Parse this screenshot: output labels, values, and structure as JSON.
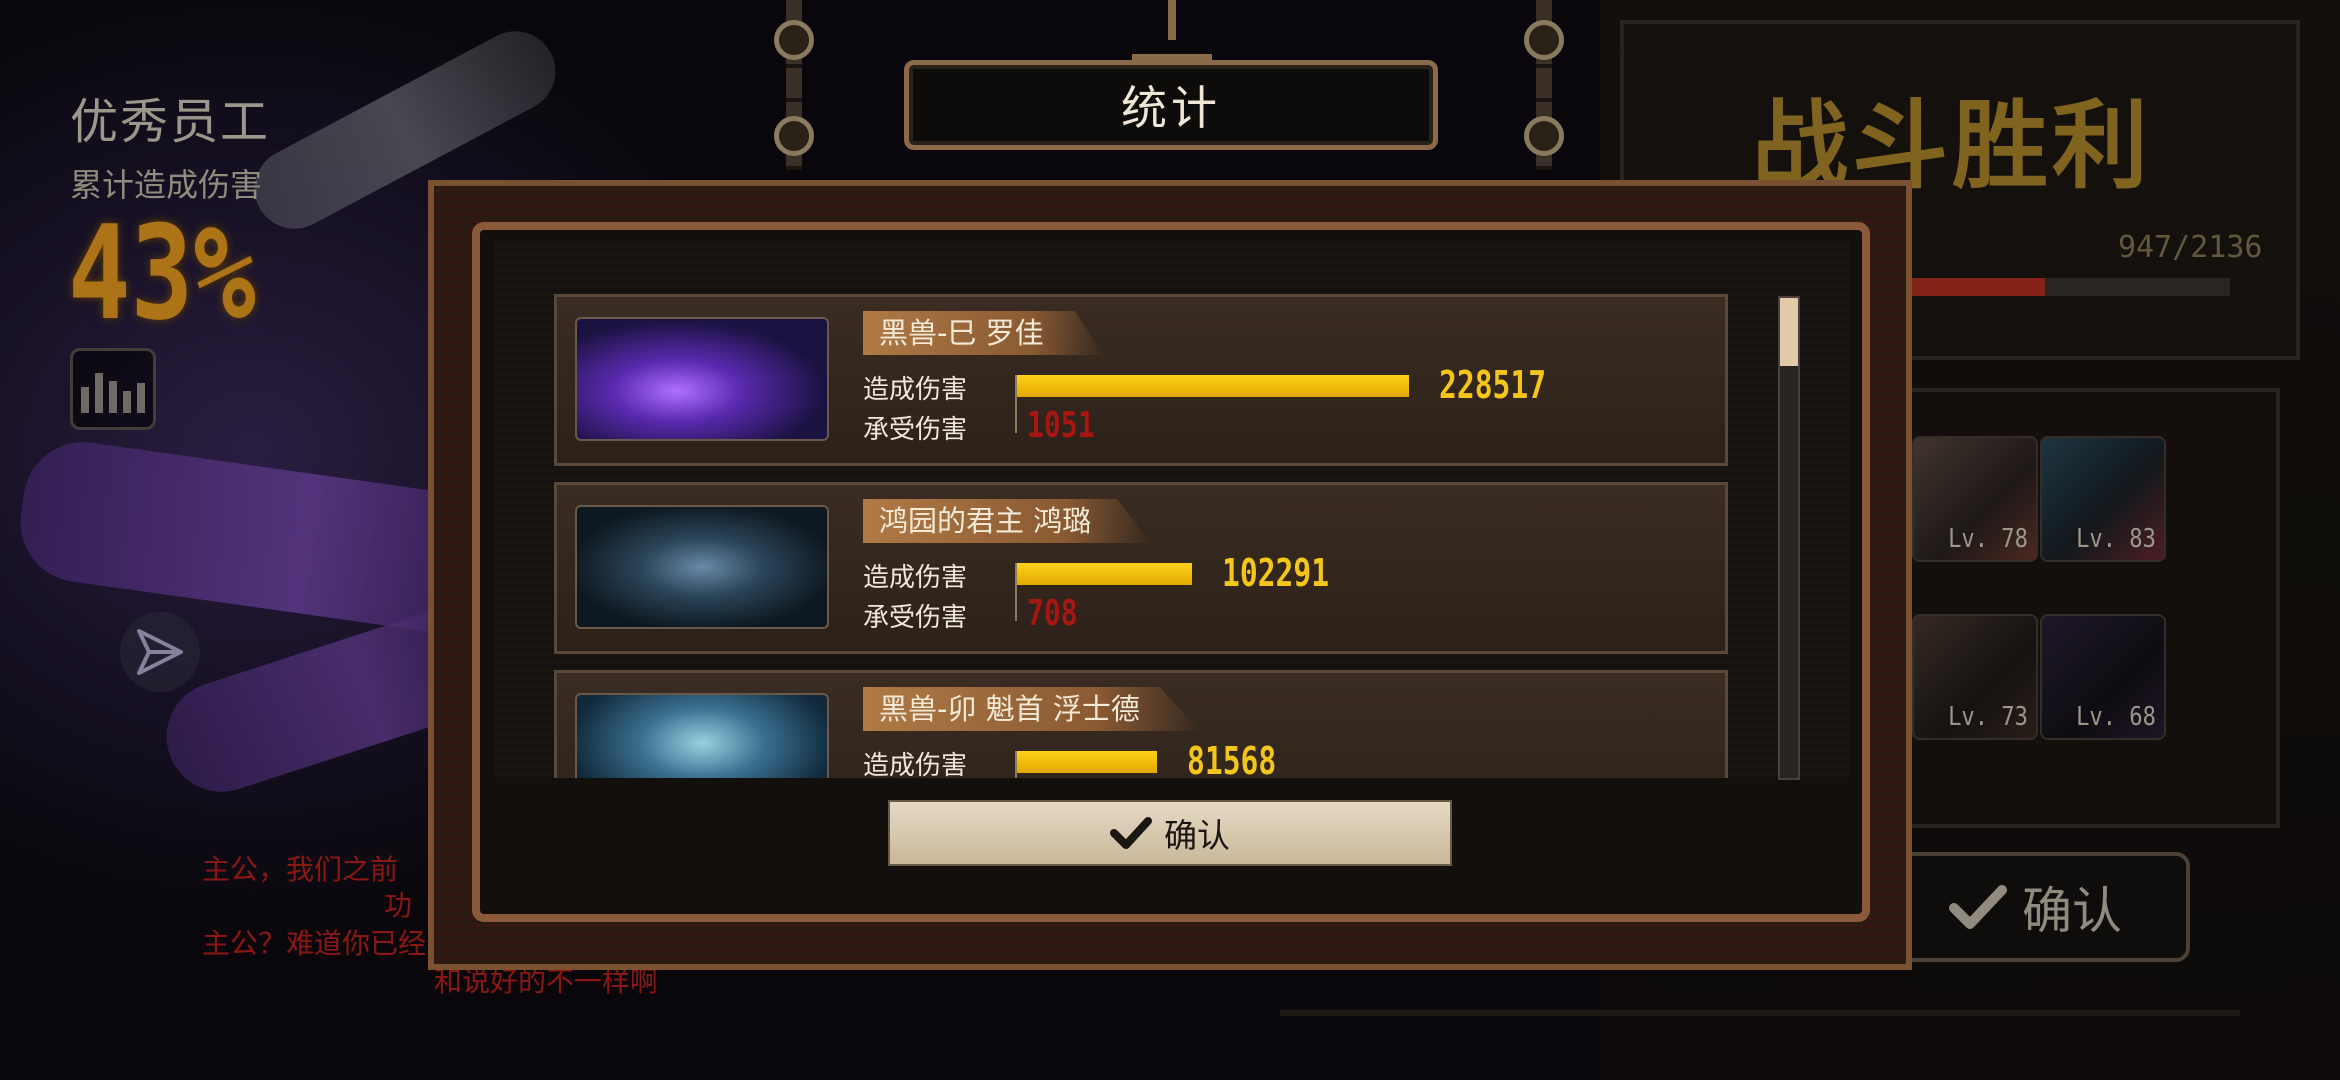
{
  "left_hud": {
    "mvp_title": "优秀员工",
    "mvp_subtitle": "累计造成伤害",
    "mvp_percent": "43%",
    "dialogue": [
      "主公，我们之前",
      "功",
      "主公？难道你已经",
      "和说好的不一样啊"
    ]
  },
  "right_hud": {
    "victory_title": "战斗胜利",
    "exp_text": "947/2136",
    "exp_fraction": 0.44,
    "levels": [
      "Lv. 78",
      "Lv. 83",
      "Lv. 73",
      "Lv. 68"
    ],
    "confirm_label": "确认"
  },
  "modal": {
    "title": "统计",
    "damage_label": "造成伤害",
    "taken_label": "承受伤害",
    "confirm_label": "确认",
    "max_damage": 228517,
    "rows": [
      {
        "name": "黑兽-巳 罗佳",
        "damage": "228517",
        "damage_value": 228517,
        "taken": "1051"
      },
      {
        "name": "鸿园的君主 鸿璐",
        "damage": "102291",
        "damage_value": 102291,
        "taken": "708"
      },
      {
        "name": "黑兽-卯 魁首 浮士德",
        "damage": "81568",
        "damage_value": 81568,
        "taken": ""
      }
    ]
  },
  "colors": {
    "accent_gold": "#f5c61a",
    "taken_red": "#a81612",
    "frame_brown": "#7a5232",
    "mvp_orange": "#f0a020"
  },
  "icons": {
    "stats": "bar-chart-icon",
    "share": "share-icon",
    "confirm": "checkmark-icon"
  }
}
